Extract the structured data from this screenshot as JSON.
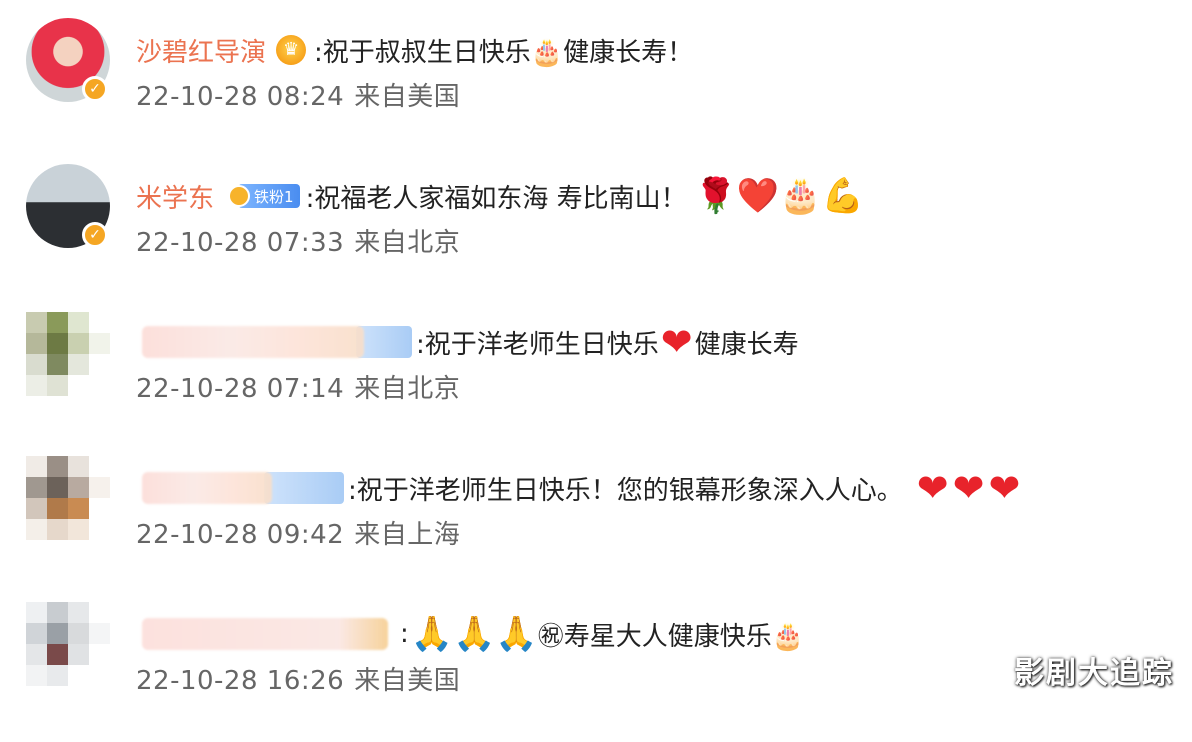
{
  "comments": [
    {
      "username": "沙碧红导演",
      "text": ":祝于叔叔生日快乐🎂健康长寿！",
      "emojis": "",
      "date": "22-10-28 08:24",
      "location": "来自美国"
    },
    {
      "username": "米学东",
      "fan_badge": "铁粉1",
      "text": ":祝福老人家福如东海 寿比南山！",
      "emojis": "🌹❤️🎂💪",
      "date": "22-10-28 07:33",
      "location": "来自北京"
    },
    {
      "username": "",
      "text": ":祝于洋老师生日快乐",
      "text_after_heart": "健康长寿",
      "date": "22-10-28 07:14",
      "location": "来自北京"
    },
    {
      "username": "",
      "text": ":祝于洋老师生日快乐！您的银幕形象深入人心。",
      "date": "22-10-28 09:42",
      "location": "来自上海"
    },
    {
      "username": "",
      "text": ":",
      "emojis": "🙏🙏🙏",
      "text_after_emoji": "㊗寿星大人健康快乐🎂",
      "date": "22-10-28 16:26",
      "location": "来自美国"
    }
  ],
  "heart_symbol": "❤",
  "crown_symbol": "♛",
  "verified_symbol": "✓",
  "watermark": "影剧大追踪"
}
